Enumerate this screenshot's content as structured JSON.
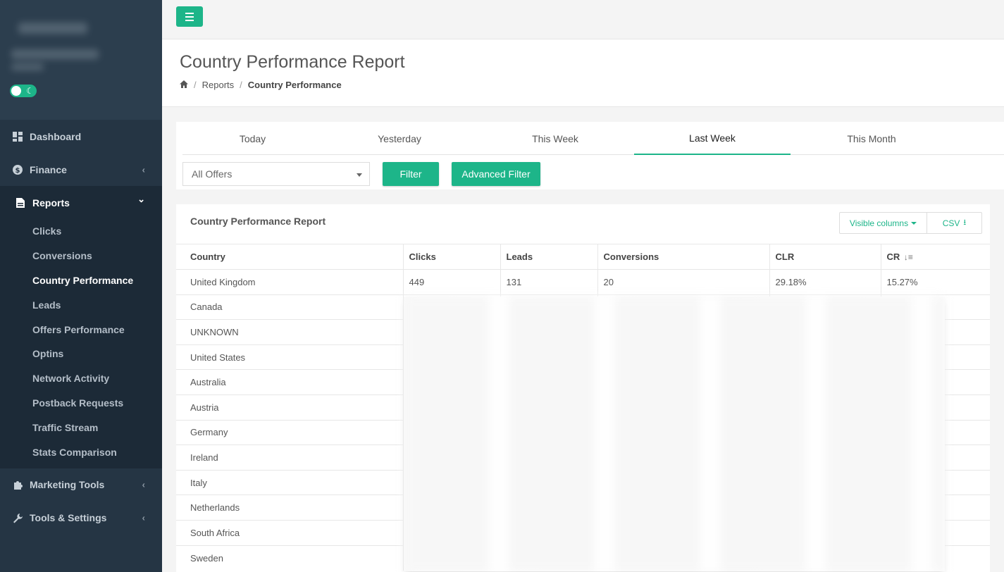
{
  "sidebar": {
    "nav": [
      {
        "label": "Dashboard",
        "icon": "dashboard-icon",
        "chevron": ""
      },
      {
        "label": "Finance",
        "icon": "dollar-icon",
        "chevron": "‹"
      },
      {
        "label": "Reports",
        "icon": "file-icon",
        "chevron": "⌄"
      }
    ],
    "report_items": [
      "Clicks",
      "Conversions",
      "Country Performance",
      "Leads",
      "Offers Performance",
      "Optins",
      "Network Activity",
      "Postback Requests",
      "Traffic Stream",
      "Stats Comparison"
    ],
    "nav_bottom": [
      {
        "label": "Marketing Tools",
        "icon": "puzzle-icon",
        "chevron": "‹"
      },
      {
        "label": "Tools & Settings",
        "icon": "wrench-icon",
        "chevron": "‹"
      }
    ]
  },
  "header": {
    "title": "Country Performance Report",
    "breadcrumb": {
      "level1": "Reports",
      "current": "Country Performance"
    }
  },
  "filters": {
    "tabs": [
      "Today",
      "Yesterday",
      "This Week",
      "Last Week",
      "This Month"
    ],
    "active_tab": "Last Week",
    "offer_select": "All Offers",
    "filter_label": "Filter",
    "advanced_label": "Advanced Filter"
  },
  "report": {
    "title": "Country Performance Report",
    "visible_columns_label": "Visible columns",
    "csv_label": "CSV",
    "columns": [
      "Country",
      "Clicks",
      "Leads",
      "Conversions",
      "CLR",
      "CR"
    ],
    "rows": [
      [
        "United Kingdom",
        "449",
        "131",
        "20",
        "29.18%",
        "15.27%"
      ],
      [
        "Canada",
        "",
        "",
        "",
        "",
        ""
      ],
      [
        "UNKNOWN",
        "",
        "",
        "",
        "",
        ""
      ],
      [
        "United States",
        "",
        "",
        "",
        "",
        ""
      ],
      [
        "Australia",
        "",
        "",
        "",
        "",
        ""
      ],
      [
        "Austria",
        "",
        "",
        "",
        "",
        ""
      ],
      [
        "Germany",
        "",
        "",
        "",
        "",
        ""
      ],
      [
        "Ireland",
        "",
        "",
        "",
        "",
        ""
      ],
      [
        "Italy",
        "",
        "",
        "",
        "",
        ""
      ],
      [
        "Netherlands",
        "",
        "",
        "",
        "",
        ""
      ],
      [
        "South Africa",
        "",
        "",
        "",
        "",
        ""
      ],
      [
        "Sweden",
        "",
        "",
        "",
        "",
        ""
      ]
    ]
  },
  "colors": {
    "accent": "#1db589",
    "sidebar": "#253544"
  }
}
